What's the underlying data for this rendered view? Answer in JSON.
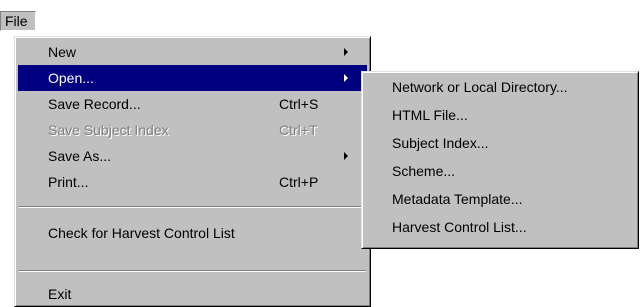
{
  "menubar": {
    "file_label": "File"
  },
  "file_menu": {
    "items": [
      {
        "label": "New",
        "shortcut": "",
        "submenu": true,
        "disabled": false,
        "highlighted": false
      },
      {
        "label": "Open...",
        "shortcut": "",
        "submenu": true,
        "disabled": false,
        "highlighted": true
      },
      {
        "label": "Save Record...",
        "shortcut": "Ctrl+S",
        "submenu": false,
        "disabled": false,
        "highlighted": false
      },
      {
        "label": "Save Subject Index",
        "shortcut": "Ctrl+T",
        "submenu": false,
        "disabled": true,
        "highlighted": false
      },
      {
        "label": "Save As...",
        "shortcut": "",
        "submenu": true,
        "disabled": false,
        "highlighted": false
      },
      {
        "label": "Print...",
        "shortcut": "Ctrl+P",
        "submenu": false,
        "disabled": false,
        "highlighted": false
      },
      {
        "label": "Check for Harvest Control List",
        "shortcut": "",
        "submenu": false,
        "disabled": false,
        "highlighted": false
      },
      {
        "label": "Exit",
        "shortcut": "",
        "submenu": false,
        "disabled": false,
        "highlighted": false
      }
    ]
  },
  "open_submenu": {
    "items": [
      {
        "label": "Network or Local Directory..."
      },
      {
        "label": "HTML File..."
      },
      {
        "label": "Subject Index..."
      },
      {
        "label": "Scheme..."
      },
      {
        "label": "Metadata Template..."
      },
      {
        "label": "Harvest Control List..."
      }
    ]
  },
  "colors": {
    "menu_background": "#c0c0c0",
    "highlight": "#000080",
    "disabled_text": "#808080"
  },
  "icons": {
    "submenu_arrow": "triangle-right-icon"
  }
}
